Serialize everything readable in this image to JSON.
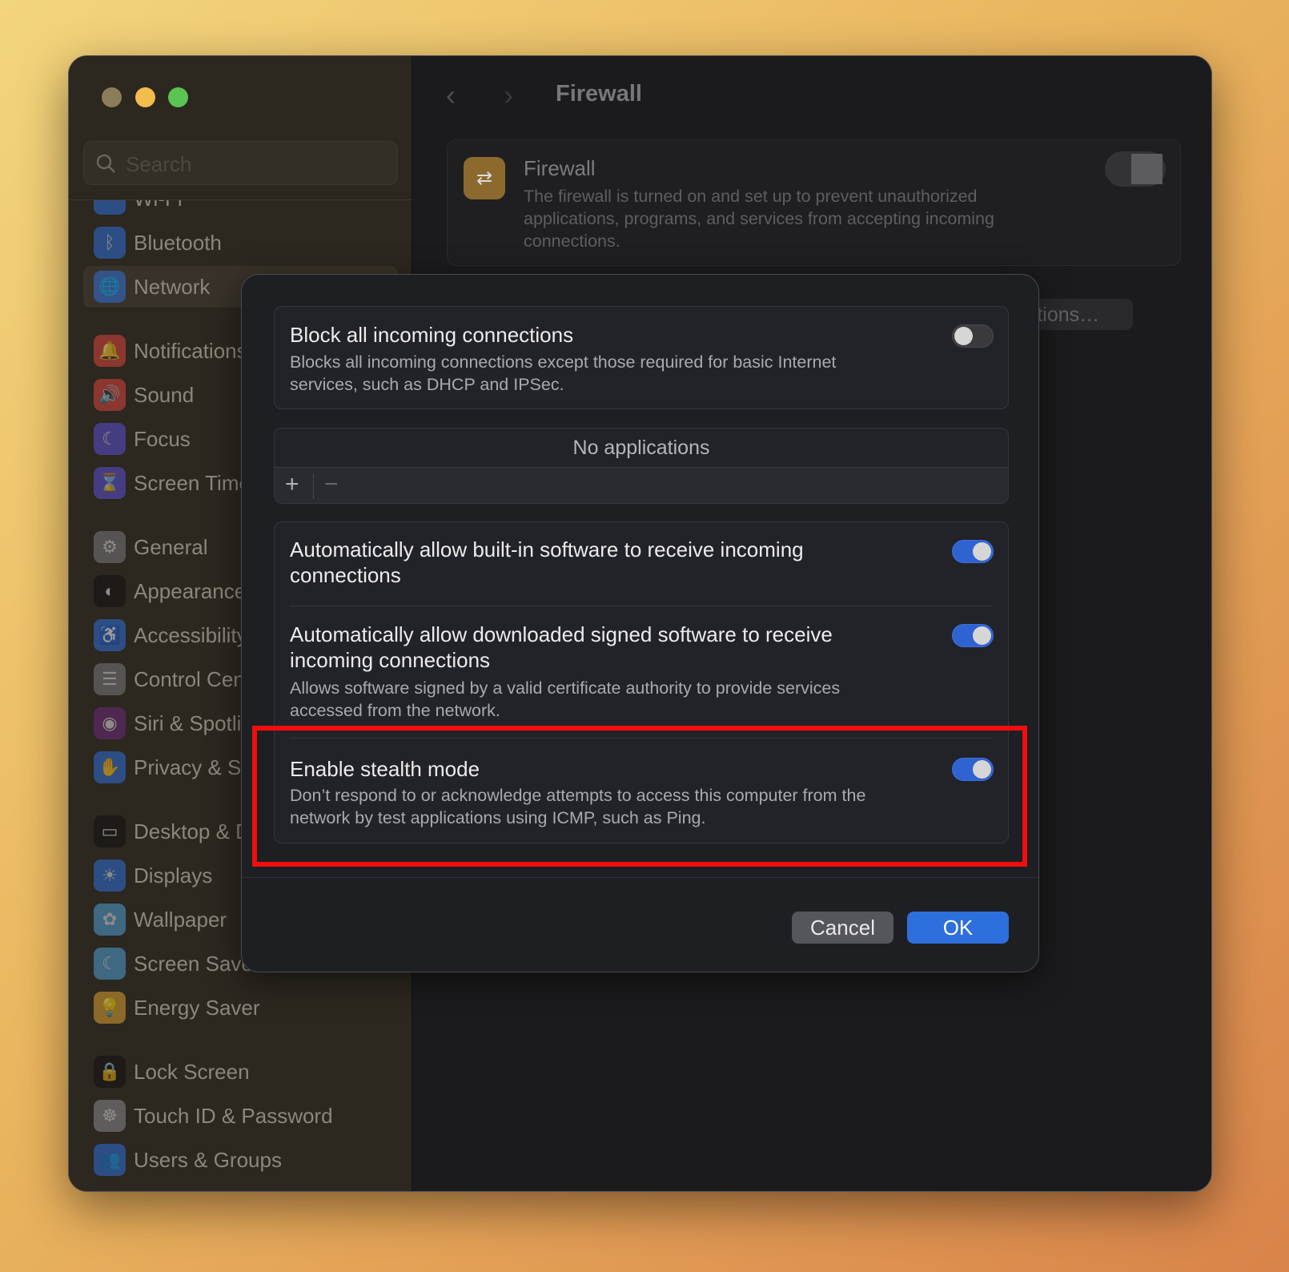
{
  "window": {
    "traffic_lights": {
      "close": "#8c7d5a",
      "minimize": "#f2bd4d",
      "zoom": "#5ac552"
    }
  },
  "sidebar": {
    "search_placeholder": "Search",
    "selected": "Network",
    "items": [
      {
        "label": "Wi-Fi",
        "icon": "wifi-icon",
        "glyph": "◠",
        "color": "#2f6fd8"
      },
      {
        "label": "Bluetooth",
        "icon": "bluetooth-icon",
        "glyph": "ᛒ",
        "color": "#2f6fd8"
      },
      {
        "label": "Network",
        "icon": "globe-icon",
        "glyph": "🌐",
        "color": "#2f6fd8"
      },
      {
        "label": "Notifications",
        "icon": "bell-icon",
        "glyph": "🔔",
        "color": "#d9443c"
      },
      {
        "label": "Sound",
        "icon": "speaker-icon",
        "glyph": "🔊",
        "color": "#d9443c"
      },
      {
        "label": "Focus",
        "icon": "moon-icon",
        "glyph": "☾",
        "color": "#5b4fd1"
      },
      {
        "label": "Screen Time",
        "icon": "hourglass-icon",
        "glyph": "⌛",
        "color": "#5b4fd1"
      },
      {
        "label": "General",
        "icon": "gear-icon",
        "glyph": "⚙",
        "color": "#7a7a7e"
      },
      {
        "label": "Appearance",
        "icon": "appearance-icon",
        "glyph": "◐",
        "color": "#111"
      },
      {
        "label": "Accessibility",
        "icon": "accessibility-icon",
        "glyph": "♿",
        "color": "#2f6fd8"
      },
      {
        "label": "Control Centre",
        "icon": "control-centre-icon",
        "glyph": "☰",
        "color": "#7a7a7e"
      },
      {
        "label": "Siri & Spotlight",
        "icon": "siri-icon",
        "glyph": "◉",
        "color": "#6b2a7a"
      },
      {
        "label": "Privacy & Security",
        "icon": "hand-icon",
        "glyph": "✋",
        "color": "#2f6fd8"
      },
      {
        "label": "Desktop & Dock",
        "icon": "desktop-icon",
        "glyph": "▭",
        "color": "#111"
      },
      {
        "label": "Displays",
        "icon": "sun-icon",
        "glyph": "☀",
        "color": "#2f6fd8"
      },
      {
        "label": "Wallpaper",
        "icon": "flower-icon",
        "glyph": "✿",
        "color": "#4f9ed6"
      },
      {
        "label": "Screen Saver",
        "icon": "screen-saver-icon",
        "glyph": "☾",
        "color": "#4f9ed6"
      },
      {
        "label": "Energy Saver",
        "icon": "lightbulb-icon",
        "glyph": "💡",
        "color": "#d9a030"
      },
      {
        "label": "Lock Screen",
        "icon": "lock-icon",
        "glyph": "🔒",
        "color": "#111"
      },
      {
        "label": "Touch ID & Password",
        "icon": "fingerprint-icon",
        "glyph": "☸",
        "color": "#8a8a8e"
      },
      {
        "label": "Users & Groups",
        "icon": "users-icon",
        "glyph": "👥",
        "color": "#2f6fd8"
      }
    ]
  },
  "header": {
    "back": "‹",
    "forward": "›",
    "title": "Firewall"
  },
  "firewall_card": {
    "title": "Firewall",
    "description": "The firewall is turned on and set up to prevent unauthorized applications, programs, and services from accepting incoming connections.",
    "enabled": true
  },
  "options_button": "Options…",
  "help_button": "?",
  "dialog": {
    "block": {
      "title": "Block all incoming connections",
      "description_lines": [
        "Blocks all incoming connections except those required for basic Internet",
        "services, such as DHCP and IPSec."
      ],
      "enabled": false
    },
    "app_list": {
      "empty_text": "No applications",
      "add": "+",
      "remove": "−"
    },
    "builtin": {
      "title_lines": [
        "Automatically allow built-in software to receive incoming",
        "connections"
      ],
      "enabled": true
    },
    "signed": {
      "title_lines": [
        "Automatically allow downloaded signed software to receive",
        "incoming connections"
      ],
      "description_lines": [
        "Allows software signed by a valid certificate authority to provide services",
        "accessed from the network."
      ],
      "enabled": true
    },
    "stealth": {
      "title": "Enable stealth mode",
      "description_lines": [
        "Don’t respond to or acknowledge attempts to access this computer from the",
        "network by test applications using ICMP, such as Ping."
      ],
      "enabled": true
    },
    "cancel": "Cancel",
    "ok": "OK"
  },
  "colors": {
    "accent": "#2f63d1",
    "highlight": "#f10d0d",
    "ok_button": "#2d6fdc"
  }
}
